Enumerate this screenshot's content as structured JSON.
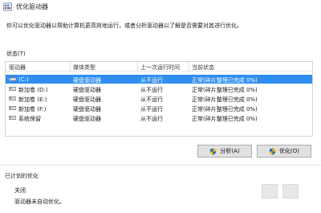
{
  "window": {
    "title": "优化驱动器",
    "icon": "defrag-app-icon"
  },
  "description": "你可以优化驱动器以帮助计算机更高效地运行，或者分析驱动器以了解是否需要对其进行优化。",
  "status_label": "状态(T)",
  "table": {
    "columns": [
      "驱动器",
      "媒体类型",
      "上一次运行时间",
      "当前状态"
    ],
    "rows": [
      {
        "drive": "(C:)",
        "media": "硬盘驱动器",
        "last_run": "从不运行",
        "status": "正常(碎片整理已完成 0%)",
        "selected": true
      },
      {
        "drive": "新加卷 (D:)",
        "media": "硬盘驱动器",
        "last_run": "从不运行",
        "status": "正常(碎片整理已完成 0%)",
        "selected": false
      },
      {
        "drive": "新加卷 (E:)",
        "media": "硬盘驱动器",
        "last_run": "从不运行",
        "status": "正常(碎片整理已完成 0%)",
        "selected": false
      },
      {
        "drive": "新加卷 (F:)",
        "media": "硬盘驱动器",
        "last_run": "从不运行",
        "status": "正常(碎片整理已完成 0%)",
        "selected": false
      },
      {
        "drive": "系统保留",
        "media": "硬盘驱动器",
        "last_run": "从不运行",
        "status": "正常(碎片整理已完成 0%)",
        "selected": false
      }
    ]
  },
  "buttons": {
    "analyze": "分析(A)",
    "optimize": "优化(O)"
  },
  "scheduled": {
    "label": "已计划的优化",
    "state": "关闭",
    "note": "驱动器未自动优化。"
  },
  "colors": {
    "selection": "#2f8ef0",
    "shield_blue": "#1f5fbf",
    "shield_yellow": "#f2c200"
  }
}
